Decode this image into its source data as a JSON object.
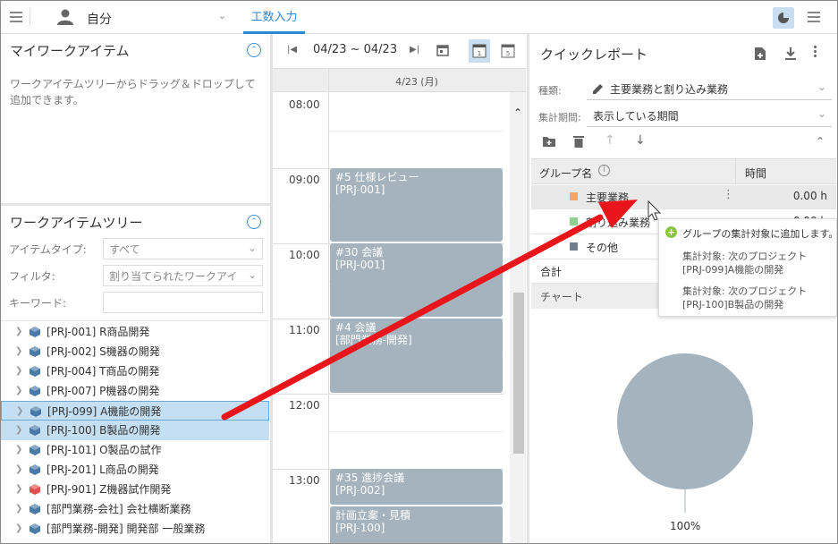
{
  "header": {
    "user_name": "自分",
    "tab_label": "工数入力"
  },
  "my_work": {
    "title": "マイワークアイテム",
    "hint": "ワークアイテムツリーからドラッグ＆ドロップして追加できます。"
  },
  "tree": {
    "title": "ワークアイテムツリー",
    "item_type_label": "アイテムタイプ:",
    "item_type_value": "すべて",
    "filter_label": "フィルタ:",
    "filter_value": "割り当てられたワークアイ",
    "keyword_label": "キーワード:",
    "keyword_value": "",
    "items": [
      {
        "label": "[PRJ-001] R商品開発",
        "color": "#4a7aa8"
      },
      {
        "label": "[PRJ-002] S機器の開発",
        "color": "#4a7aa8"
      },
      {
        "label": "[PRJ-004] T商品の開発",
        "color": "#4a7aa8"
      },
      {
        "label": "[PRJ-007] P機器の開発",
        "color": "#4a7aa8"
      },
      {
        "label": "[PRJ-099] A機能の開発",
        "color": "#4a7aa8"
      },
      {
        "label": "[PRJ-100] B製品の開発",
        "color": "#4a7aa8"
      },
      {
        "label": "[PRJ-101] O製品の試作",
        "color": "#4a7aa8"
      },
      {
        "label": "[PRJ-201] L商品の開発",
        "color": "#4a7aa8"
      },
      {
        "label": "[PRJ-901] Z機器試作開発",
        "color": "#d9534f"
      },
      {
        "label": "[部門業務-会社] 会社横断業務",
        "color": "#4a7aa8"
      },
      {
        "label": "[部門業務-開発] 開発部 一般業務",
        "color": "#4a7aa8"
      }
    ]
  },
  "calendar": {
    "range": "04/23 ~ 04/23",
    "day_header": "4/23 (月)",
    "hours": [
      "08:00",
      "09:00",
      "10:00",
      "11:00",
      "12:00",
      "13:00"
    ],
    "events": [
      {
        "title": "#5 仕様レビュー",
        "project": "[PRJ-001]"
      },
      {
        "title": "#30 会議",
        "project": "[PRJ-001]"
      },
      {
        "title": "#4 会議",
        "project": "[部門業務-開発]"
      },
      {
        "title": "#35 進捗会議",
        "project": "[PRJ-002]"
      },
      {
        "title": "計画立案・見積",
        "project": "[PRJ-100]"
      }
    ]
  },
  "quick_report": {
    "title": "クイックレポート",
    "kind_label": "種類:",
    "kind_value": "主要業務と割り込み業務",
    "period_label": "集計期間:",
    "period_value": "表示している期間",
    "col_group": "グループ名",
    "col_time": "時間",
    "groups": [
      {
        "name": "主要業務",
        "time": "0.00 h",
        "color": "#f0a868"
      },
      {
        "name": "割り込み業務",
        "time": "0.00 h",
        "color": "#8fd18f"
      },
      {
        "name": "その他",
        "time": "",
        "color": "#6f7f8f"
      }
    ],
    "total_label": "合計",
    "chart_label": "チャート",
    "pie_percent": "100%"
  },
  "tooltip": {
    "heading": "グループの集計対象に追加します。",
    "line1a": "集計対象: 次のプロジェクト",
    "line1b": "[PRJ-099]A機能の開発",
    "line2a": "集計対象: 次のプロジェクト",
    "line2b": "[PRJ-100]B製品の開発"
  }
}
